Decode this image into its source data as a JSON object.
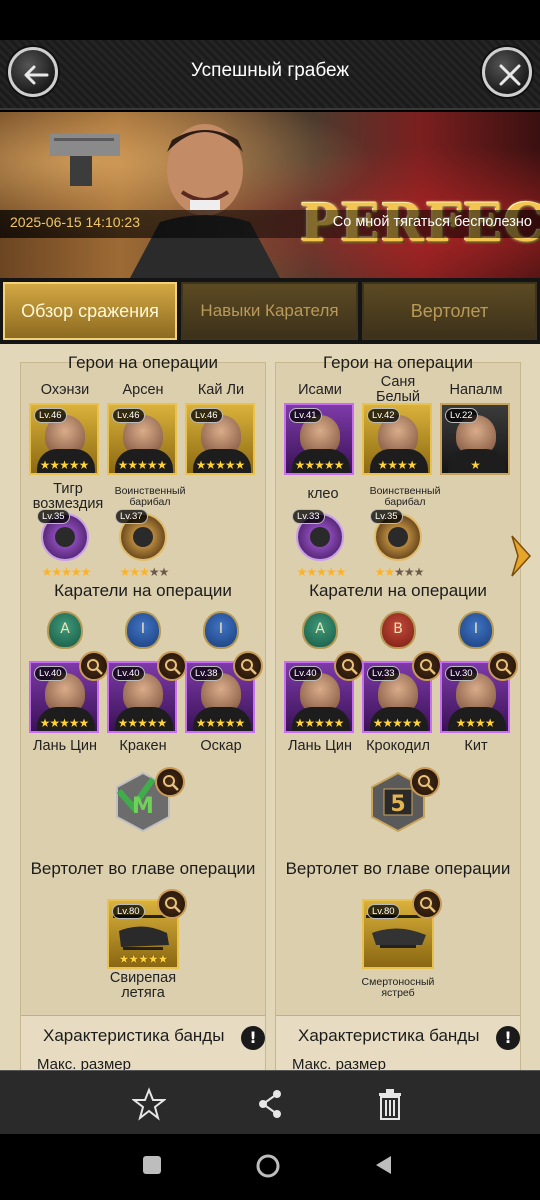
{
  "header": {
    "title": "Успешный грабеж"
  },
  "banner": {
    "result_text": "PERFECT",
    "timestamp": "2025-06-15  14:10:23",
    "slogan": "Со мной тягаться бесполезно"
  },
  "tabs": [
    {
      "label": "Обзор сражения",
      "active": true
    },
    {
      "label": "Навыки Карателя",
      "active": false
    },
    {
      "label": "Вертолет",
      "active": false
    }
  ],
  "left": {
    "heroes_heading": "Герои на операции",
    "heroes": [
      {
        "name": "Охэнзи",
        "level": "Lv.46",
        "stars": "★★★★★"
      },
      {
        "name": "Арсен",
        "level": "Lv.46",
        "stars": "★★★★★"
      },
      {
        "name": "Кай Ли",
        "level": "Lv.46",
        "stars": "★★★★★"
      }
    ],
    "pets": [
      {
        "name": "Тигр возмездия",
        "level": "Lv.35",
        "stars_on": "★★★★★",
        "stars_off": ""
      },
      {
        "name": "Воинственный барибал",
        "level": "Lv.37",
        "stars_on": "★★★",
        "stars_off": "★★"
      }
    ],
    "punishers_heading": "Каратели на операции",
    "punishers": [
      {
        "name": "Лань Цин",
        "level": "Lv.40",
        "stars": "★★★★★",
        "class": "A"
      },
      {
        "name": "Кракен",
        "level": "Lv.40",
        "stars": "★★★★★",
        "class": "I"
      },
      {
        "name": "Оскар",
        "level": "Lv.38",
        "stars": "★★★★★",
        "class": "I"
      }
    ],
    "emblem": "M",
    "heli_heading": "Вертолет во главе операции",
    "heli": {
      "name": "Свирепая летяга",
      "level": "Lv.80",
      "stars": "★★★★★"
    },
    "stats_title": "Характеристика банды",
    "stats_sub": "Макс. размер"
  },
  "right": {
    "heroes_heading": "Герои на операции",
    "heroes": [
      {
        "name": "Исами",
        "level": "Lv.41",
        "stars": "★★★★★"
      },
      {
        "name": "Саня Белый",
        "level": "Lv.42",
        "stars": "★★★★"
      },
      {
        "name": "Напалм",
        "level": "Lv.22",
        "stars": "★"
      }
    ],
    "pets": [
      {
        "name": "клео",
        "level": "Lv.33",
        "stars_on": "★★★★★",
        "stars_off": ""
      },
      {
        "name": "Воинственный барибал",
        "level": "Lv.35",
        "stars_on": "★★",
        "stars_off": "★★★"
      }
    ],
    "punishers_heading": "Каратели на операции",
    "punishers": [
      {
        "name": "Лань Цин",
        "level": "Lv.40",
        "stars": "★★★★★",
        "class": "A"
      },
      {
        "name": "Крокодил",
        "level": "Lv.33",
        "stars": "★★★★★",
        "class": "B"
      },
      {
        "name": "Кит",
        "level": "Lv.30",
        "stars": "★★★★",
        "class": "I"
      }
    ],
    "emblem": "5",
    "heli_heading": "Вертолет во главе операции",
    "heli": {
      "name": "Смертоносный ястреб",
      "level": "Lv.80",
      "stars": ""
    },
    "stats_title": "Характеристика банды",
    "stats_sub": "Макс. размер"
  },
  "icons": {
    "back": "arrow-left-icon",
    "close": "close-icon",
    "next": "chevron-right-icon",
    "favorite": "star-icon",
    "share": "share-icon",
    "delete": "trash-icon",
    "zoom": "magnifier-icon",
    "recent": "square-icon",
    "home": "circle-icon",
    "back_nav": "triangle-back-icon"
  },
  "colors": {
    "gold": "#d3a743",
    "panel": "#dccfae",
    "active_text": "#fff8d8",
    "inactive_text": "#b99a59"
  }
}
